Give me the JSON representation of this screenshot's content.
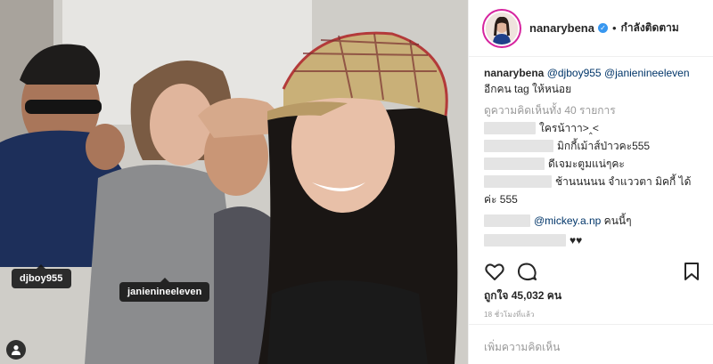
{
  "post": {
    "photo_tags": {
      "tag1": "djboy955",
      "tag2": "janienineeleven"
    },
    "icons": {
      "user_tags": "person-icon",
      "like": "heart-icon",
      "comment": "comment-bubble-icon",
      "save": "bookmark-icon",
      "verified": "verified-badge-icon"
    }
  },
  "header": {
    "username": "nanarybena",
    "separator": "•",
    "follow_state": "กำลังติดตาม"
  },
  "caption": {
    "username": "nanarybena",
    "mention1": "@djboy955",
    "mention2": "@janienineeleven",
    "text": "อีกคน tag ให้หน่อย"
  },
  "view_all_comments": "ดูความคิดเห็นทั้ง 40 รายการ",
  "comments": [
    {
      "text": "ใครน้าาา>‸<"
    },
    {
      "text": "มิกกี้เม้าส์ป่าวคะ555"
    },
    {
      "text": "ดีเจมะตูมแน่ๆคะ"
    },
    {
      "text": "ช้านนนนน จำแววตา มิคกี้ ได้"
    },
    {
      "text": "ค่ะ 555"
    },
    {
      "mention": "@mickey.a.np",
      "text": "คนนี้ๆ"
    },
    {
      "text": "♥♥"
    }
  ],
  "likes": "ถูกใจ 45,032 คน",
  "timestamp": "18 ชั่วโมงที่แล้ว",
  "add_comment_placeholder": "เพิ่มความคิดเห็น",
  "colors": {
    "verified": "#3897f0",
    "mention": "#003569",
    "muted": "#999999",
    "tag_bg": "#141414"
  }
}
